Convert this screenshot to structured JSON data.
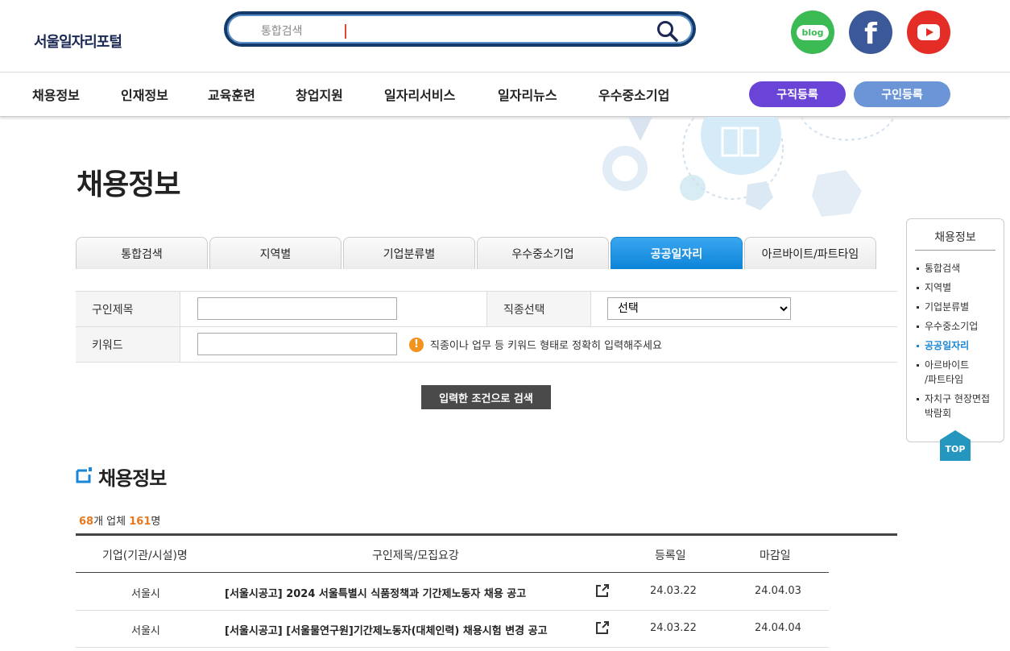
{
  "header": {
    "logo": "서울일자리포털",
    "search_placeholder": "통합검색",
    "social": [
      "blog",
      "f"
    ]
  },
  "gnb": {
    "items": [
      "채용정보",
      "인재정보",
      "교육훈련",
      "창업지원",
      "일자리서비스",
      "일자리뉴스",
      "우수중소기업"
    ],
    "seeker_btn": "구직등록",
    "employer_btn": "구인등록"
  },
  "page_title": "채용정보",
  "tabs": [
    "통합검색",
    "지역별",
    "기업분류별",
    "우수중소기업",
    "공공일자리",
    "아르바이트/파트타임"
  ],
  "active_tab": "공공일자리",
  "form": {
    "title_label": "구인제목",
    "job_label": "직종선택",
    "job_selected": "선택",
    "keyword_label": "키워드",
    "hint": "직종이나 업무 등 키워드 형태로 정확히 입력해주세요",
    "submit": "입력한 조건으로 검색"
  },
  "section": {
    "title": "채용정보",
    "company_count": "68",
    "company_unit": "개 업체",
    "people_count": "161",
    "people_unit": "명"
  },
  "table": {
    "headers": [
      "기업(기관/시설)명",
      "구인제목/모집요강",
      "등록일",
      "마감일"
    ],
    "rows": [
      {
        "org": "서울시",
        "title": "[서울시공고] 2024 서울특별시 식품정책과 기간제노동자 채용 공고",
        "reg": "24.03.22",
        "due": "24.04.03"
      },
      {
        "org": "서울시",
        "title": "[서울시공고] [서울물연구원]기간제노동자(대체인력) 채용시험 변경 공고",
        "reg": "24.03.22",
        "due": "24.04.04"
      }
    ]
  },
  "quick_menu": {
    "title": "채용정보",
    "items": [
      "통합검색",
      "지역별",
      "기업분류별",
      "우수중소기업",
      "공공일자리",
      "아르바이트\n/파트타임",
      "자치구 현장면접 박람회"
    ],
    "top": "TOP"
  }
}
